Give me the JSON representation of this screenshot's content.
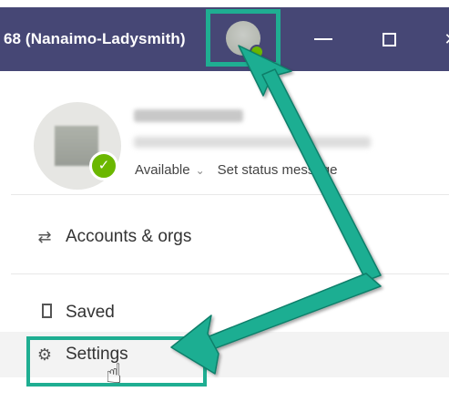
{
  "titlebar": {
    "title": "68 (Nanaimo-Ladysmith)",
    "minimize": "—",
    "close": "✕"
  },
  "profile": {
    "status": "Available",
    "status_caret": "⌄",
    "set_status": "Set status message"
  },
  "menu": {
    "accounts": "Accounts & orgs",
    "saved": "Saved",
    "settings": "Settings"
  },
  "icons": {
    "accounts": "⇄",
    "settings": "⚙",
    "cursor": "☝"
  },
  "colors": {
    "titlebar": "#464775",
    "highlight": "#1fae92",
    "presence": "#6bb700"
  }
}
